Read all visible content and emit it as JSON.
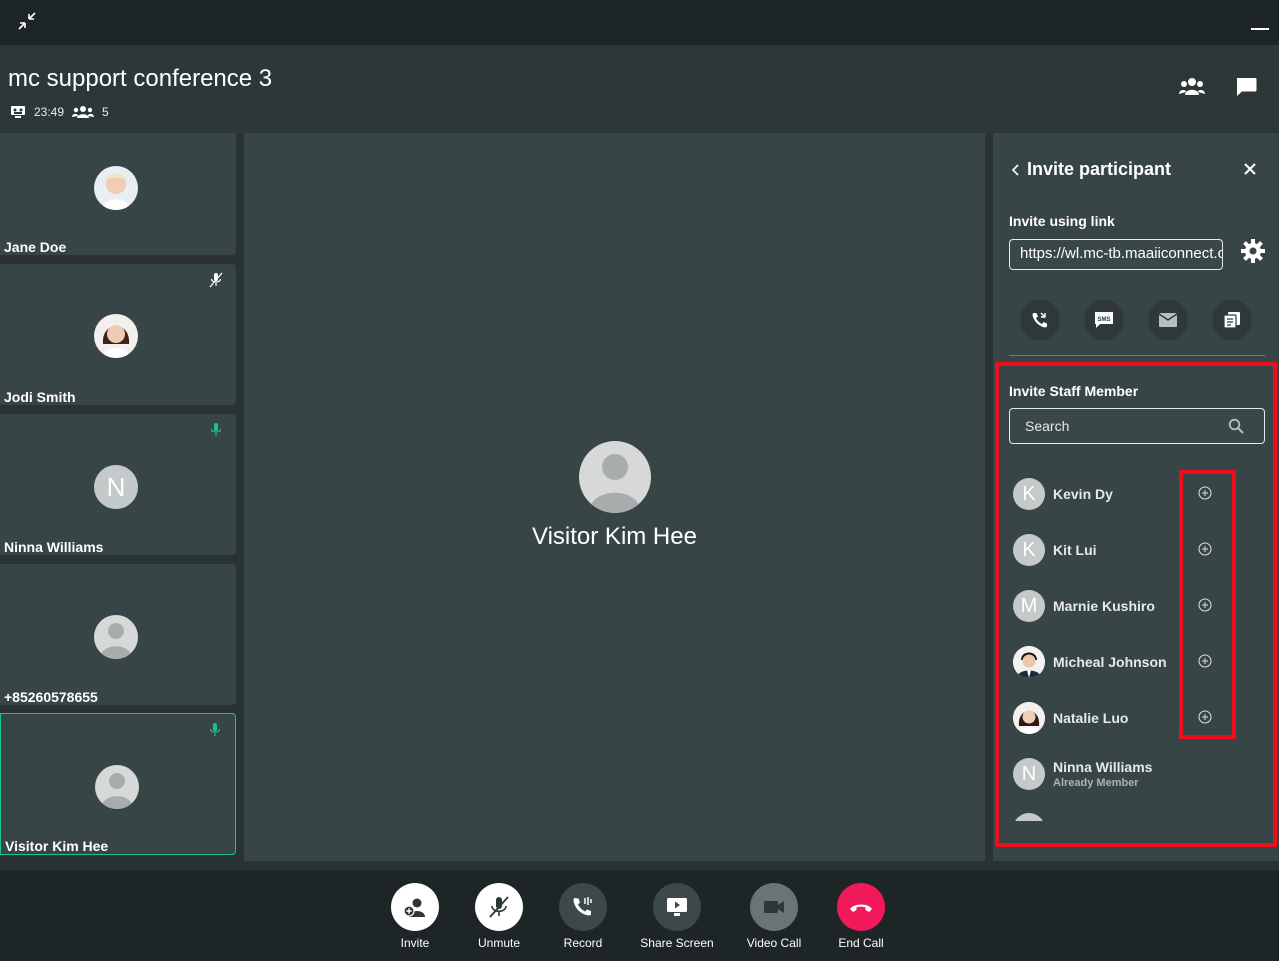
{
  "conference": {
    "title": "mc support conference 3",
    "duration": "23:49",
    "participant_count": "5"
  },
  "tiles": [
    {
      "name": "Jane Doe",
      "avatar": "photo",
      "mic": "none"
    },
    {
      "name": "Jodi Smith",
      "avatar": "photo",
      "mic": "muted"
    },
    {
      "name": "Ninna Williams",
      "avatar": "N",
      "mic": "active"
    },
    {
      "name": "+85260578655",
      "avatar": "default",
      "mic": "none"
    },
    {
      "name": "Visitor Kim Hee",
      "avatar": "default",
      "mic": "active",
      "selected": true
    }
  ],
  "main_video": {
    "name": "Visitor Kim Hee"
  },
  "invite_panel": {
    "title": "Invite participant",
    "link_label": "Invite using link",
    "link_value": "https://wl.mc-tb.maaiiconnect.com/",
    "staff_label": "Invite Staff Member",
    "search_placeholder": "Search",
    "staff": [
      {
        "name": "Kevin Dy",
        "initial": "K",
        "status": ""
      },
      {
        "name": "Kit Lui",
        "initial": "K",
        "status": ""
      },
      {
        "name": "Marnie Kushiro",
        "initial": "M",
        "status": ""
      },
      {
        "name": "Micheal Johnson",
        "initial": "",
        "status": ""
      },
      {
        "name": "Natalie Luo",
        "initial": "",
        "status": ""
      },
      {
        "name": "Ninna Williams",
        "initial": "N",
        "status": "Already Member"
      }
    ]
  },
  "controls": {
    "invite": "Invite",
    "unmute": "Unmute",
    "record": "Record",
    "share_screen": "Share Screen",
    "video_call": "Video Call",
    "end_call": "End Call"
  },
  "colors": {
    "accent_green": "#19c48a",
    "end_call_red": "#f2195a",
    "highlight_red": "#ee0f1b"
  }
}
